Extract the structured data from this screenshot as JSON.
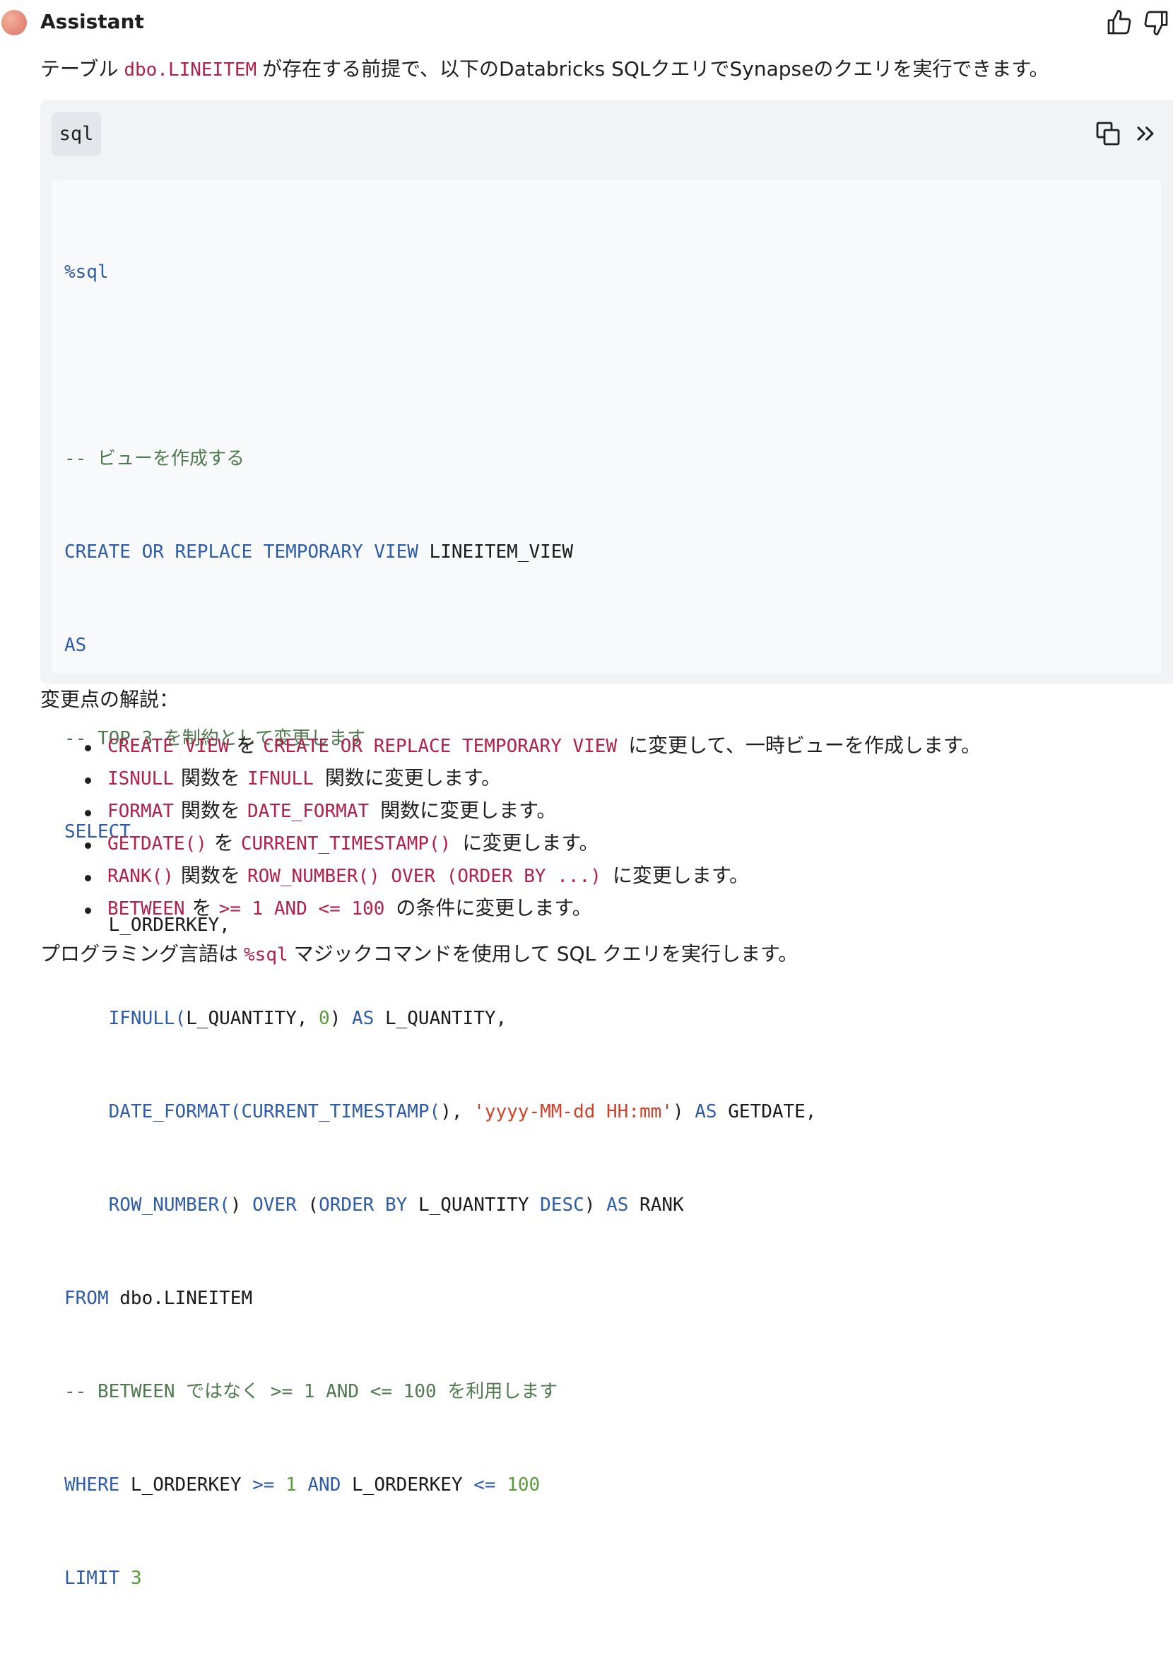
{
  "header": {
    "name": "Assistant",
    "thumbs_up_icon": "thumbs-up-icon",
    "thumbs_down_icon": "thumbs-down-icon"
  },
  "intro": {
    "before": "テーブル",
    "table": "dbo.LINEITEM",
    "after": "が存在する前提で、以下のDatabricks SQLクエリでSynapseのクエリを実行できます。"
  },
  "code_block": {
    "language": "sql",
    "copy_icon": "copy-icon",
    "expand_icon": "chevron-double-right-icon",
    "lines": {
      "l1": "%sql",
      "l3": "-- ビューを作成する",
      "l4a": "CREATE OR REPLACE TEMPORARY VIEW",
      "l4b": " LINEITEM_VIEW",
      "l5": "AS",
      "l6": "-- TOP 3 を制約として変更します",
      "l7": "SELECT",
      "l8": "    L_ORDERKEY,",
      "l9a": "    IFNULL(",
      "l9b": "L_QUANTITY, ",
      "l9c": "0",
      "l9d": ") ",
      "l9e": "AS",
      "l9f": " L_QUANTITY,",
      "l10a": "    DATE_FORMAT(CURRENT_TIMESTAMP(",
      "l10b": "), ",
      "l10c": "'yyyy-MM-dd HH:mm'",
      "l10d": ") ",
      "l10e": "AS",
      "l10f": " GETDATE,",
      "l11a": "    ROW_NUMBER(",
      "l11b": ") ",
      "l11c": "OVER",
      "l11d": " (",
      "l11e": "ORDER BY",
      "l11f": " L_QUANTITY ",
      "l11g": "DESC",
      "l11h": ") ",
      "l11i": "AS",
      "l11j": " RANK",
      "l12a": "FROM",
      "l12b": " dbo.LINEITEM",
      "l13": "-- BETWEEN ではなく >= 1 AND <= 100 を利用します",
      "l14a": "WHERE",
      "l14b": " L_ORDERKEY ",
      "l14c": ">=",
      "l14d": " ",
      "l14e": "1",
      "l14f": " ",
      "l14g": "AND",
      "l14h": " L_ORDERKEY ",
      "l14i": "<=",
      "l14j": " ",
      "l14k": "100",
      "l15a": "LIMIT",
      "l15b": " ",
      "l15c": "3"
    }
  },
  "explanation_title": "変更点の解説：",
  "changes": [
    {
      "from": "CREATE VIEW",
      "mid": "を",
      "to": "CREATE OR REPLACE TEMPORARY VIEW",
      "after": "に変更して、一時ビューを作成します。"
    },
    {
      "from": "ISNULL",
      "mid": "関数を",
      "to": "IFNULL",
      "after": "関数に変更します。"
    },
    {
      "from": "FORMAT",
      "mid": "関数を",
      "to": "DATE_FORMAT",
      "after": "関数に変更します。"
    },
    {
      "from": "GETDATE()",
      "mid": "を",
      "to": "CURRENT_TIMESTAMP()",
      "after": "に変更します。"
    },
    {
      "from": "RANK()",
      "mid": "関数を",
      "to": "ROW_NUMBER() OVER (ORDER BY ...)",
      "after": "に変更します。"
    },
    {
      "from": "BETWEEN",
      "mid": "を",
      "to": ">= 1 AND <= 100",
      "after": "の条件に変更します。"
    }
  ],
  "footer": {
    "before": "プログラミング言語は",
    "code": "%sql",
    "after": "マジックコマンドを使用して SQL クエリを実行します。"
  }
}
